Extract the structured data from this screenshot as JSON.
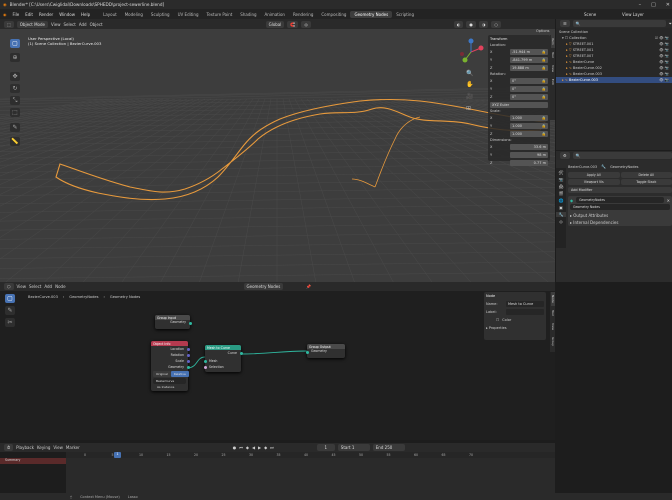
{
  "window": {
    "title": "Blender* [C:\\Users\\Cwiglidal\\Downloads\\SPHEDD\\project-sewerline.blend]"
  },
  "menu": [
    "File",
    "Edit",
    "Render",
    "Window",
    "Help"
  ],
  "workspaces": [
    "Layout",
    "Modeling",
    "Sculpting",
    "UV Editing",
    "Texture Paint",
    "Shading",
    "Animation",
    "Rendering",
    "Compositing",
    "Geometry Nodes",
    "Scripting"
  ],
  "active_workspace": "Geometry Nodes",
  "scene": {
    "name": "Scene",
    "view_layer": "View Layer"
  },
  "viewport": {
    "mode": "Object Mode",
    "menus": [
      "View",
      "Select",
      "Add",
      "Object"
    ],
    "transform": "Global",
    "info_line1": "User Perspective (Local)",
    "info_line2": "(1) Scene Collection | BezierCurve.003",
    "options": "Options"
  },
  "npanel": {
    "title": "Transform",
    "location": {
      "label": "Location:",
      "x": "-51.944 m",
      "y": "-841.799 m",
      "z": "19.888 m"
    },
    "rotation": {
      "label": "Rotation:",
      "x": "0°",
      "y": "0°",
      "z": "0°",
      "mode": "XYZ Euler"
    },
    "scale": {
      "label": "Scale:",
      "x": "1.000",
      "y": "1.000",
      "z": "1.000"
    },
    "dimensions": {
      "label": "Dimensions:",
      "x": "33.6 m",
      "y": "98 m",
      "z": "0.77 m"
    },
    "tabs": [
      "Item",
      "Tool",
      "View",
      "Edit"
    ]
  },
  "outliner": {
    "items": [
      {
        "name": "Scene Collection"
      },
      {
        "name": "Collection"
      },
      {
        "name": "STREET.001"
      },
      {
        "name": "STREET.001"
      },
      {
        "name": "STREET.007"
      },
      {
        "name": "BezierCurve"
      },
      {
        "name": "BezierCurve.002"
      },
      {
        "name": "BezierCurve.003"
      },
      {
        "name": "BezierCurve.003"
      }
    ]
  },
  "properties": {
    "object": "BezierCurve.003",
    "modifier_tab": "GeometryNodes",
    "buttons": [
      "Apply All",
      "Delete All",
      "Viewport Vis",
      "Toggle Stack"
    ],
    "add_modifier": "Add Modifier",
    "modifier_name": "GeometryNodes",
    "nodegroup": "Geometry Nodes",
    "sections": [
      "Output Attributes",
      "Internal Dependencies"
    ]
  },
  "node_editor": {
    "menus": [
      "View",
      "Select",
      "Add",
      "Node"
    ],
    "breadcrumb": [
      "BezierCurve.003",
      "GeometryNodes",
      "Geometry Nodes"
    ],
    "group_name": "Geometry Nodes",
    "nodes": {
      "input1": {
        "title": "Group Input",
        "sockets": [
          "Geometry"
        ]
      },
      "obj_info": {
        "title": "Object Info",
        "outputs": [
          "Location",
          "Rotation",
          "Scale",
          "Geometry"
        ],
        "toggle": [
          "Original",
          "Relative"
        ],
        "object": "BezierCurve",
        "as_instance": "As Instance"
      },
      "mesh2curve": {
        "title": "Mesh to Curve",
        "outputs": [
          "Curve"
        ],
        "inputs": [
          "Mesh",
          "Selection"
        ]
      },
      "output": {
        "title": "Group Output",
        "inputs": [
          "Geometry"
        ]
      }
    },
    "panel": {
      "title": "Node",
      "name_label": "Name:",
      "name": "Mesh to Curve",
      "label_label": "Label:",
      "color": "Color",
      "properties": "Properties"
    }
  },
  "timeline": {
    "menus": [
      "Playback",
      "Keying",
      "View",
      "Marker"
    ],
    "frame": "1",
    "start_label": "Start",
    "start": "1",
    "end_label": "End",
    "end": "250",
    "summary": "Summary",
    "ticks": [
      "0",
      "5",
      "10",
      "15",
      "20",
      "25",
      "30",
      "35",
      "40",
      "45",
      "50",
      "55",
      "60",
      "65",
      "70"
    ]
  },
  "status": {
    "items": [
      "Context Menu (Mouse)",
      "Lasso"
    ]
  }
}
